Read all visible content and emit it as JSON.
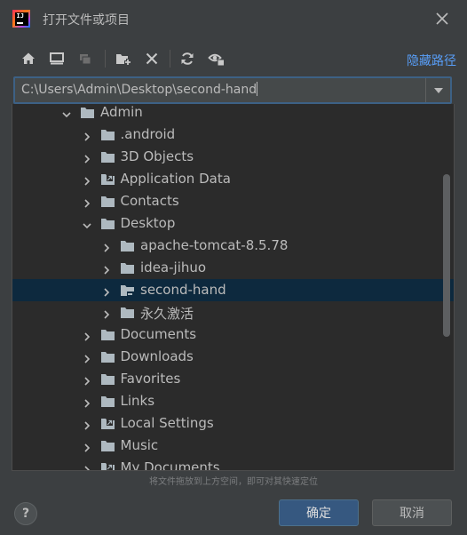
{
  "window": {
    "title": "打开文件或项目",
    "app_icon": "intellij-idea-icon"
  },
  "toolbar": {
    "buttons": [
      "home-icon",
      "desktop-icon",
      "project-icon",
      "new-folder-icon",
      "delete-icon",
      "refresh-icon",
      "show-hidden-icon"
    ],
    "hide_path_label": "隐藏路径"
  },
  "path": {
    "value": "C:\\Users\\Admin\\Desktop\\second-hand"
  },
  "tree": {
    "rows": [
      {
        "label": "Admin",
        "expanded": true,
        "symlink": false
      },
      {
        "label": ".android",
        "expanded": false,
        "symlink": false
      },
      {
        "label": "3D Objects",
        "expanded": false,
        "symlink": false
      },
      {
        "label": "Application Data",
        "expanded": false,
        "symlink": true
      },
      {
        "label": "Contacts",
        "expanded": false,
        "symlink": false
      },
      {
        "label": "Desktop",
        "expanded": true,
        "symlink": false
      },
      {
        "label": "apache-tomcat-8.5.78",
        "expanded": false,
        "symlink": false
      },
      {
        "label": "idea-jihuo",
        "expanded": false,
        "symlink": false
      },
      {
        "label": "second-hand",
        "expanded": false,
        "symlink": false,
        "selected": true
      },
      {
        "label": "永久激活",
        "expanded": false,
        "symlink": false
      },
      {
        "label": "Documents",
        "expanded": false,
        "symlink": false
      },
      {
        "label": "Downloads",
        "expanded": false,
        "symlink": false
      },
      {
        "label": "Favorites",
        "expanded": false,
        "symlink": false
      },
      {
        "label": "Links",
        "expanded": false,
        "symlink": false
      },
      {
        "label": "Local Settings",
        "expanded": false,
        "symlink": true
      },
      {
        "label": "Music",
        "expanded": false,
        "symlink": false
      },
      {
        "label": "My Documents",
        "expanded": false,
        "symlink": true
      }
    ]
  },
  "footer": {
    "hint": "将文件拖放到上方空间，即可对其快速定位",
    "help_label": "?",
    "ok_label": "确定",
    "cancel_label": "取消"
  },
  "colors": {
    "background": "#3c3f41",
    "tree_background": "#2b2b2b",
    "selection": "#0d293e",
    "accent_link": "#589df6",
    "primary_button": "#365880"
  }
}
